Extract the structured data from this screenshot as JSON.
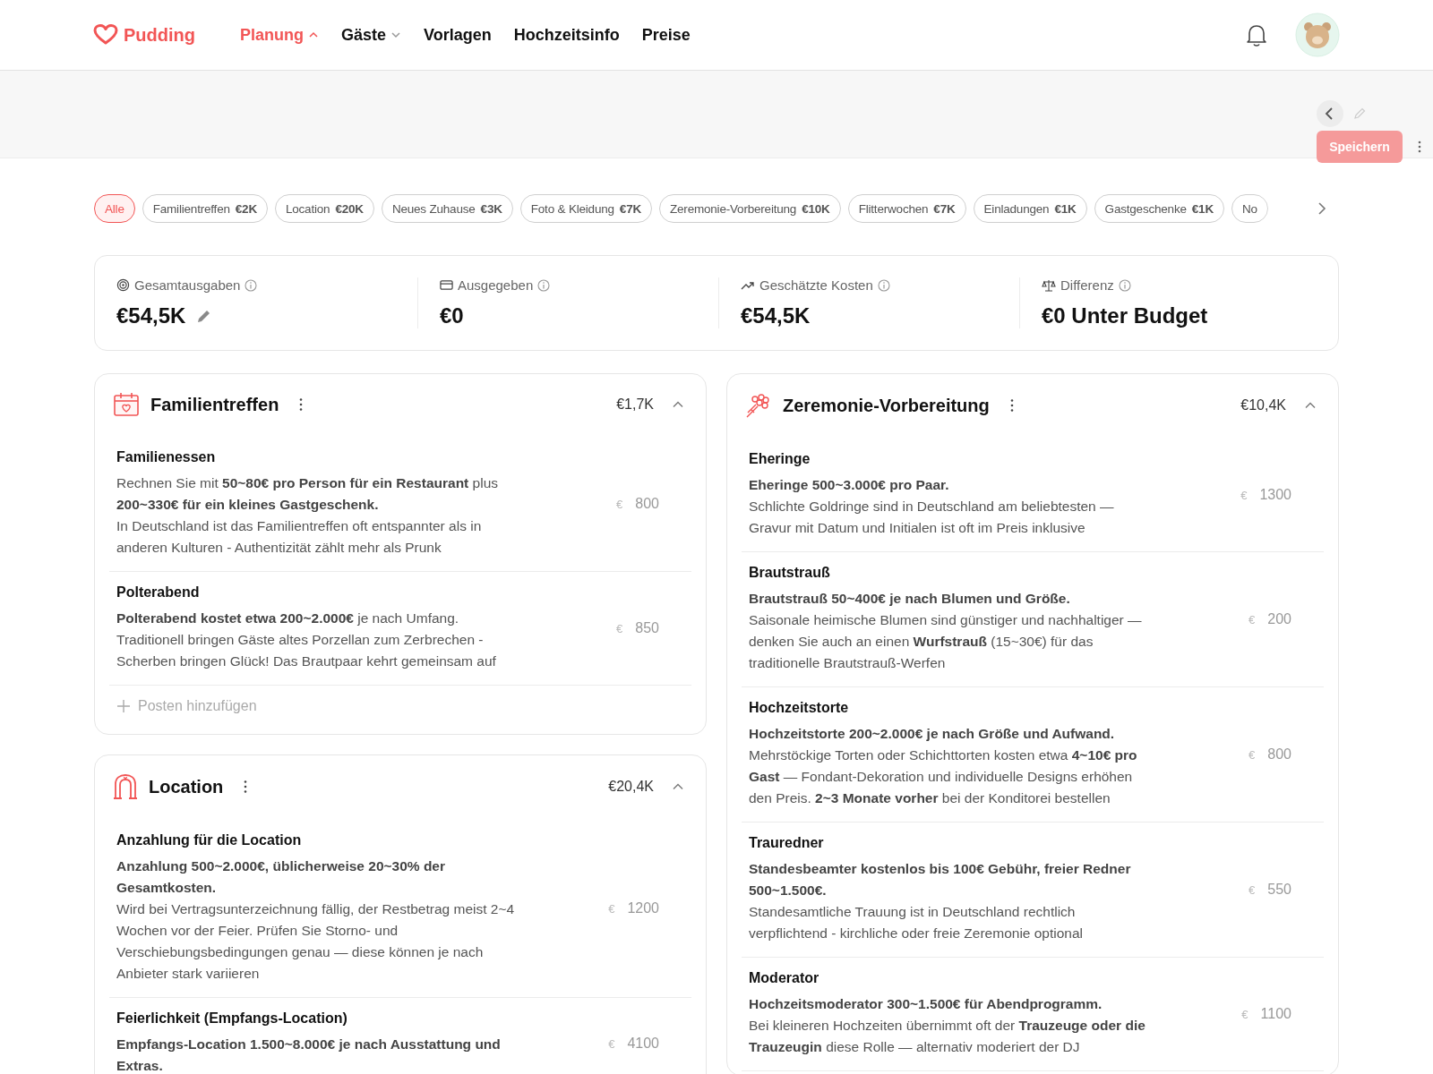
{
  "nav": {
    "logo": "Pudding",
    "links": [
      {
        "label": "Planung",
        "selected": true,
        "menu_open": true
      },
      {
        "label": "Gäste",
        "selected": false,
        "menu_open": false
      },
      {
        "label": "Vorlagen",
        "selected": false
      },
      {
        "label": "Hochzeitsinfo",
        "selected": false
      },
      {
        "label": "Preise",
        "selected": false
      }
    ]
  },
  "toolbar": {
    "save": "Speichern"
  },
  "filters": [
    {
      "label": "Alle",
      "selected": true
    },
    {
      "label": "Familientreffen",
      "amount": "€2K",
      "selected": false
    },
    {
      "label": "Location",
      "amount": "€20K",
      "selected": false
    },
    {
      "label": "Neues Zuhause",
      "amount": "€3K",
      "selected": false
    },
    {
      "label": "Foto & Kleidung",
      "amount": "€7K",
      "selected": false
    },
    {
      "label": "Zeremonie-Vorbereitung",
      "amount": "€10K",
      "selected": false
    },
    {
      "label": "Flitterwochen",
      "amount": "€7K",
      "selected": false
    },
    {
      "label": "Einladungen",
      "amount": "€1K",
      "selected": false
    },
    {
      "label": "Gastgeschenke",
      "amount": "€1K",
      "selected": false
    },
    {
      "label": "No",
      "selected": false
    }
  ],
  "summary": [
    {
      "kind": "target",
      "label": "Gesamtausgaben",
      "value": "€54,5K",
      "editable": true
    },
    {
      "kind": "card",
      "label": "Ausgegeben",
      "value": "€0"
    },
    {
      "kind": "trend",
      "label": "Geschätzte Kosten",
      "value": "€54,5K"
    },
    {
      "kind": "scale",
      "label": "Differenz",
      "value": "€0 Unter Budget"
    }
  ],
  "columns": [
    [
      {
        "kind": "calendar",
        "title": "Familientreffen",
        "total": "€1,7K",
        "expanded": true,
        "add_label": "Posten hinzufügen",
        "items": [
          {
            "title": "Familienessen",
            "paragraphs": [
              "Rechnen Sie mit **50~80€ pro Person für ein Restaurant** plus **200~330€ für ein kleines Gastgeschenk.**",
              "In Deutschland ist das Familientreffen oft entspannter als in anderen Kulturen - Authentizität zählt mehr als Prunk"
            ],
            "currency": "€",
            "amount": "800"
          },
          {
            "title": "Polterabend",
            "paragraphs": [
              "**Polterabend kostet etwa 200~2.000€** je nach Umfang.",
              "Traditionell bringen Gäste altes Porzellan zum Zerbrechen - Scherben bringen Glück! Das Brautpaar kehrt gemeinsam auf"
            ],
            "currency": "€",
            "amount": "850"
          }
        ]
      },
      {
        "kind": "arch",
        "title": "Location",
        "total": "€20,4K",
        "expanded": true,
        "items": [
          {
            "title": "Anzahlung für die Location",
            "paragraphs": [
              "**Anzahlung 500~2.000€, üblicherweise 20~30% der Gesamtkosten.**",
              "Wird bei Vertragsunterzeichnung fällig, der Restbetrag meist 2~4 Wochen vor der Feier. Prüfen Sie Storno- und Verschiebungsbedingungen genau — diese können je nach Anbieter stark variieren"
            ],
            "currency": "€",
            "amount": "1200"
          },
          {
            "title": "Feierlichkeit (Empfangs-Location)",
            "paragraphs": [
              "**Empfangs-Location 1.500~8.000€ je nach Ausstattung und Extras.**"
            ],
            "currency": "€",
            "amount": "4100"
          }
        ]
      }
    ],
    [
      {
        "kind": "bouquet",
        "title": "Zeremonie-Vorbereitung",
        "total": "€10,4K",
        "expanded": true,
        "items": [
          {
            "title": "Eheringe",
            "paragraphs": [
              "**Eheringe 500~3.000€ pro Paar.**",
              "Schlichte Goldringe sind in Deutschland am beliebtesten — Gravur mit Datum und Initialen ist oft im Preis inklusive"
            ],
            "currency": "€",
            "amount": "1300"
          },
          {
            "title": "Brautstrauß",
            "paragraphs": [
              "**Brautstrauß 50~400€ je nach Blumen und Größe.**",
              "Saisonale heimische Blumen sind günstiger und nachhaltiger — denken Sie auch an einen **Wurfstrauß** (15~30€) für das traditionelle Brautstrauß-Werfen"
            ],
            "currency": "€",
            "amount": "200"
          },
          {
            "title": "Hochzeitstorte",
            "paragraphs": [
              "**Hochzeitstorte 200~2.000€ je nach Größe und Aufwand.**",
              "Mehrstöckige Torten oder Schichttorten kosten etwa **4~10€ pro Gast** — Fondant-Dekoration und individuelle Designs erhöhen den Preis. **2~3 Monate vorher** bei der Konditorei bestellen"
            ],
            "currency": "€",
            "amount": "800"
          },
          {
            "title": "Trauredner",
            "paragraphs": [
              "**Standesbeamter kostenlos bis 100€ Gebühr, freier Redner 500~1.500€.**",
              "Standesamtliche Trauung ist in Deutschland rechtlich verpflichtend - kirchliche oder freie Zeremonie optional"
            ],
            "currency": "€",
            "amount": "550"
          },
          {
            "title": "Moderator",
            "paragraphs": [
              "**Hochzeitsmoderator 300~1.500€ für Abendprogramm.**",
              "Bei kleineren Hochzeiten übernimmt oft der **Trauzeuge oder die Trauzeugin** diese Rolle — alternativ moderiert der DJ"
            ],
            "currency": "€",
            "amount": "1100"
          }
        ]
      }
    ]
  ]
}
